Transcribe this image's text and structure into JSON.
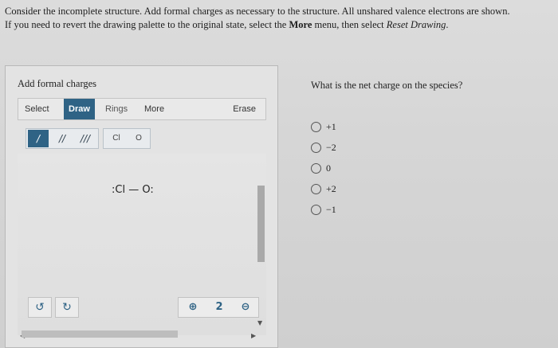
{
  "instructions": {
    "line1": "Consider the incomplete structure. Add formal charges as necessary to the structure. All unshared valence electrons are shown.",
    "line2_pre": "If you need to revert the drawing palette to the original state, select the ",
    "line2_bold": "More",
    "line2_mid": " menu, then select ",
    "line2_italic": "Reset Drawing",
    "line2_end": "."
  },
  "palette": {
    "title": "Add formal charges",
    "toolbar": {
      "select": "Select",
      "draw": "Draw",
      "rings": "Rings",
      "more": "More",
      "erase": "Erase"
    },
    "bonds": {
      "single": "/",
      "double": "//",
      "triple": "///"
    },
    "atoms": {
      "chlorine": "Cl",
      "oxygen": "O"
    },
    "molecule": {
      "atom1": ":Cl",
      "bond": "—",
      "atom2": "O:"
    },
    "history": {
      "undo_icon": "↺",
      "redo_icon": "↻"
    },
    "zoom": {
      "zoom_in_icon": "⊕",
      "reset_icon": "2",
      "zoom_out_icon": "⊖"
    }
  },
  "question": {
    "prompt": "What is the net charge on the species?",
    "options": [
      "+1",
      "−2",
      "0",
      "+2",
      "−1"
    ]
  },
  "colors": {
    "accent": "#2f6385"
  }
}
